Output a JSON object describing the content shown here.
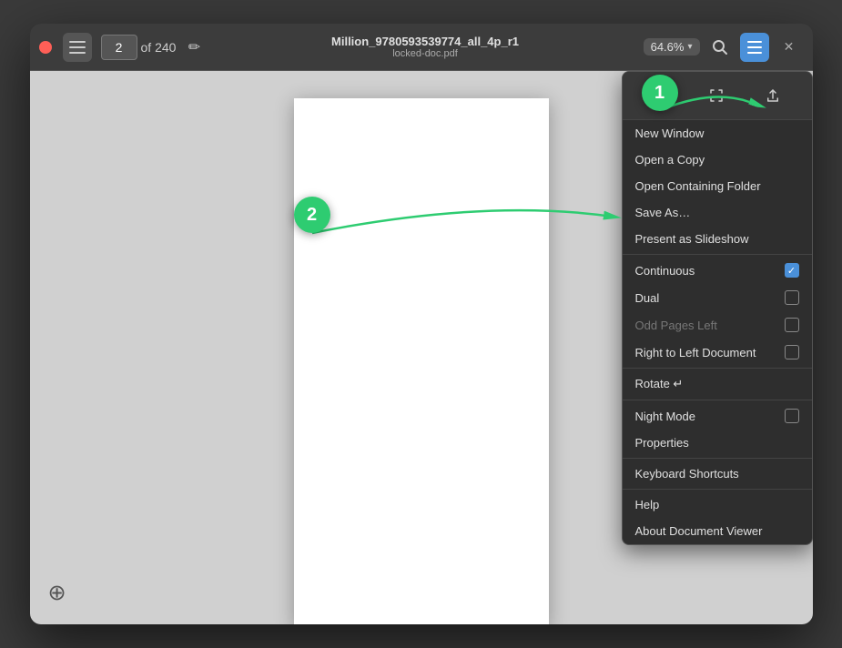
{
  "titlebar": {
    "page_number": "2",
    "page_of": "of 240",
    "title_main": "Million_9780593539774_all_4p_r1",
    "title_sub": "locked-doc.pdf",
    "zoom_level": "64.6%",
    "edit_icon": "✏"
  },
  "menu": {
    "toolbar": {
      "print_icon": "🖨",
      "fullscreen_icon": "⛶",
      "share_icon": "⬆"
    },
    "items": [
      {
        "label": "New Window",
        "has_checkbox": false,
        "checked": false,
        "disabled": false
      },
      {
        "label": "Open a Copy",
        "has_checkbox": false,
        "checked": false,
        "disabled": false
      },
      {
        "label": "Open Containing Folder",
        "has_checkbox": false,
        "checked": false,
        "disabled": false
      },
      {
        "label": "Save As…",
        "has_checkbox": false,
        "checked": false,
        "disabled": false
      },
      {
        "label": "Present as Slideshow",
        "has_checkbox": false,
        "checked": false,
        "disabled": false
      },
      {
        "label": "Continuous",
        "has_checkbox": true,
        "checked": true,
        "disabled": false
      },
      {
        "label": "Dual",
        "has_checkbox": true,
        "checked": false,
        "disabled": false
      },
      {
        "label": "Odd Pages Left",
        "has_checkbox": true,
        "checked": false,
        "disabled": true
      },
      {
        "label": "Right to Left Document",
        "has_checkbox": true,
        "checked": false,
        "disabled": false
      },
      {
        "label": "Rotate ↵",
        "has_checkbox": false,
        "checked": false,
        "disabled": false
      },
      {
        "label": "Night Mode",
        "has_checkbox": true,
        "checked": false,
        "disabled": false
      },
      {
        "label": "Properties",
        "has_checkbox": false,
        "checked": false,
        "disabled": false
      },
      {
        "label": "Keyboard Shortcuts",
        "has_checkbox": false,
        "checked": false,
        "disabled": false
      },
      {
        "label": "Help",
        "has_checkbox": false,
        "checked": false,
        "disabled": false
      },
      {
        "label": "About Document Viewer",
        "has_checkbox": false,
        "checked": false,
        "disabled": false
      }
    ]
  },
  "annotations": {
    "circle_1_label": "1",
    "circle_2_label": "2"
  },
  "separators_after": [
    4,
    8,
    9,
    11,
    12
  ]
}
